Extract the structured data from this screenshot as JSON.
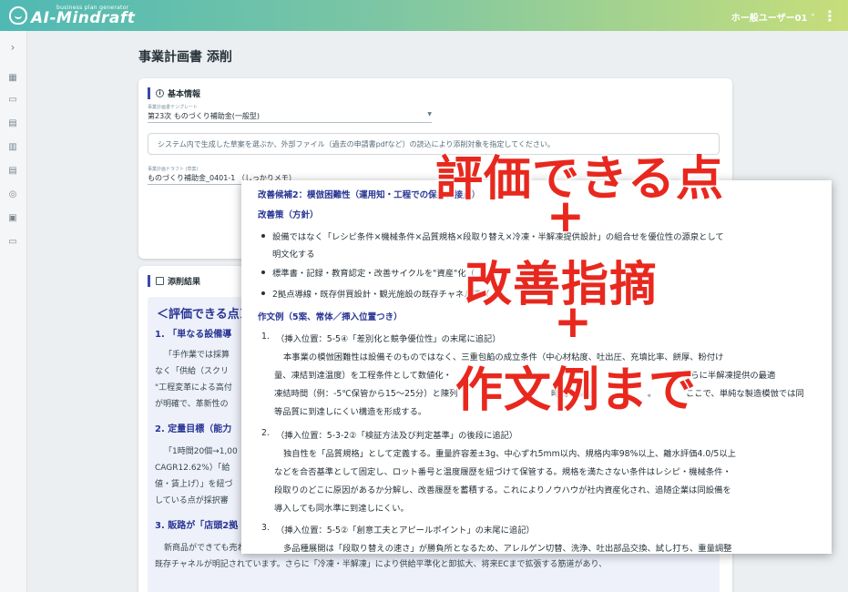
{
  "header": {
    "logo_sub": "business plan generator",
    "logo_main": "AI-Mindraft",
    "user": "ホー般ユーザー01 ˅",
    "menu_icon": "more-vert-icon"
  },
  "sidebar": {
    "toggle": "›",
    "items": [
      "grid-icon",
      "chat-icon",
      "document-edit-icon",
      "document-icon",
      "document-list-icon",
      "user-icon",
      "clipboard-icon",
      "folder-icon"
    ]
  },
  "page": {
    "title": "事業計画書 添削"
  },
  "basic": {
    "section_title": "基本情報",
    "template_label": "事業計画書テンプレート",
    "template_value": "第23次 ものづくり補助金(一般型)",
    "hint": "システム内で生成した草案を選ぶか、外部ファイル（過去の申請書pdfなど）の読込により添削対象を指定してください。",
    "draft_label": "事業計画ドラフト (草案)",
    "draft_value": "ものづくり補助金_0401-1 （しっかりメモ）"
  },
  "review": {
    "section_title": "添削結果",
    "heading": "＜評価できる点＞",
    "items": [
      {
        "h": "1. 「単なる設備導",
        "p": [
          "「手作業では採算",
          "なく「供給（スクリ",
          "\"工程変革による高付",
          "が明確で、革新性の"
        ]
      },
      {
        "h": "2. 定量目標（能力",
        "p": [
          "「1時間20個→1,00",
          "CAGR12.62%）「給",
          "値・賃上げ）」を紐づ",
          "している点が採択審"
        ]
      },
      {
        "h": "3. 販路が「店頭2拠",
        "p": [
          "新商品ができても売れない（販路だけ）という不安を成功に取り除き、二拠点の店舗・EC・近隣観光施設・地元卸業者など",
          "既存チャネルが明記されています。さらに「冷凍・半解凍」により供給平準化と卸拡大、将来ECまで拡張する筋道があり、"
        ]
      }
    ]
  },
  "overlay": {
    "title": "改善候補2：模倣困難性（運用知・工程での保持、接点）",
    "policy": "改善策（方針）",
    "bullets": [
      [
        "設備ではなく「レシピ条件×機械条件×品質規格×段取り替え×冷凍・半解凍提供設計」の組合せを優位性の源泉として",
        "明文化する"
      ],
      [
        "標準書・記録・教育認定・改善サイクルを\"資産\"化（",
        "）する"
      ],
      [
        "2拠点導線・既存併買設計・観光施設の既存チャネル等（",
        "）"
      ]
    ],
    "examples_title": "作文例（5案、常体／挿入位置つき）",
    "examples": [
      {
        "n": "1.",
        "head": "（挿入位置：5-5④「差別化と競争優位性」の末尾に追記）",
        "body": [
          "本事業の模倣困難性は設備そのものではなく、三重包餡の成立条件（中心材粘度、吐出圧、充填比率、餅厚、粉付け",
          "量、凍結到達温度）を工程条件として数値化・",
          "凍結時間（例：-5℃保管から15〜25分）と陳列",
          "時間と製品",
          "等品質に到達しにくい構造を形成する。"
        ]
      },
      {
        "n": "2.",
        "head": "（挿入位置：5-3-2②「検証方法及び判定基準」の後段に追記）",
        "body": [
          "独自性を「品質規格」として定義する。重量許容差±3g、中心ずれ5mm以内、規格内率98%以上、離水評価4.0/5以上",
          "などを合否基準として固定し、ロット番号と温度履歴を紐づけて保管する。規格を満たさない条件はレシピ・機械条件・",
          "段取りのどこに原因があるか分解し、改善履歴を蓄積する。これによりノウハウが社内資産化され、追随企業は同設備を",
          "導入しても同水準に到達しにくい。"
        ]
      },
      {
        "n": "3.",
        "head": "（挿入位置：5-5②「創意工夫とアピールポイント」の末尾に追記）",
        "body": [
          "多品種展開は「段取り替えの速さ」が勝負所となるため、アレルゲン切替、洗浄、吐出部品交換、試し打ち、重量調整"
        ]
      }
    ],
    "ex1_tail": [
      "さらに半解凍提供の最適",
      "。",
      "ここで、単純な製造模倣では同"
    ]
  },
  "captions": {
    "line1": "評価できる点",
    "plus": "+",
    "line2": "改善指摘",
    "line3": "作文例まで"
  }
}
